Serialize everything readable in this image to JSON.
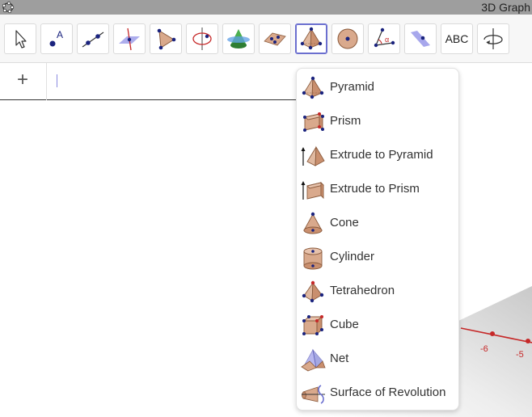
{
  "window": {
    "title": "3D Graph"
  },
  "toolbar": {
    "abc_label": "ABC",
    "tools": [
      {
        "name": "move-tool",
        "icon": "arrow-cursor-icon"
      },
      {
        "name": "point-tool",
        "icon": "point-icon"
      },
      {
        "name": "line-tool",
        "icon": "line-icon"
      },
      {
        "name": "perpendicular-tool",
        "icon": "perpendicular-line-icon"
      },
      {
        "name": "polygon-tool",
        "icon": "polygon-icon"
      },
      {
        "name": "circle-axis-tool",
        "icon": "circle-around-axis-icon"
      },
      {
        "name": "intersect-tool",
        "icon": "intersect-surfaces-icon"
      },
      {
        "name": "plane-tool",
        "icon": "plane-through-points-icon"
      },
      {
        "name": "pyramid-tool",
        "icon": "pyramid-icon",
        "active": true
      },
      {
        "name": "sphere-tool",
        "icon": "sphere-icon"
      },
      {
        "name": "angle-tool",
        "icon": "angle-icon"
      },
      {
        "name": "reflect-tool",
        "icon": "reflect-about-plane-icon"
      },
      {
        "name": "text-tool",
        "icon": "text-icon"
      },
      {
        "name": "rotate-view-tool",
        "icon": "rotate-view-icon"
      }
    ]
  },
  "algebra": {
    "add_label": "+"
  },
  "graphics": {
    "tick_labels": [
      "-6",
      "-5"
    ]
  },
  "menu": {
    "items": [
      {
        "label": "Pyramid",
        "icon": "pyramid-icon"
      },
      {
        "label": "Prism",
        "icon": "prism-icon"
      },
      {
        "label": "Extrude to Pyramid",
        "icon": "extrude-to-pyramid-icon"
      },
      {
        "label": "Extrude to Prism",
        "icon": "extrude-to-prism-icon"
      },
      {
        "label": "Cone",
        "icon": "cone-icon"
      },
      {
        "label": "Cylinder",
        "icon": "cylinder-icon"
      },
      {
        "label": "Tetrahedron",
        "icon": "tetrahedron-icon"
      },
      {
        "label": "Cube",
        "icon": "cube-icon"
      },
      {
        "label": "Net",
        "icon": "net-icon"
      },
      {
        "label": "Surface of Revolution",
        "icon": "surface-of-revolution-icon"
      }
    ]
  },
  "colors": {
    "accent": "#6b6fcf",
    "point": "#1a237e",
    "solid_fill": "#d9a98c",
    "axis": "#c62828"
  }
}
